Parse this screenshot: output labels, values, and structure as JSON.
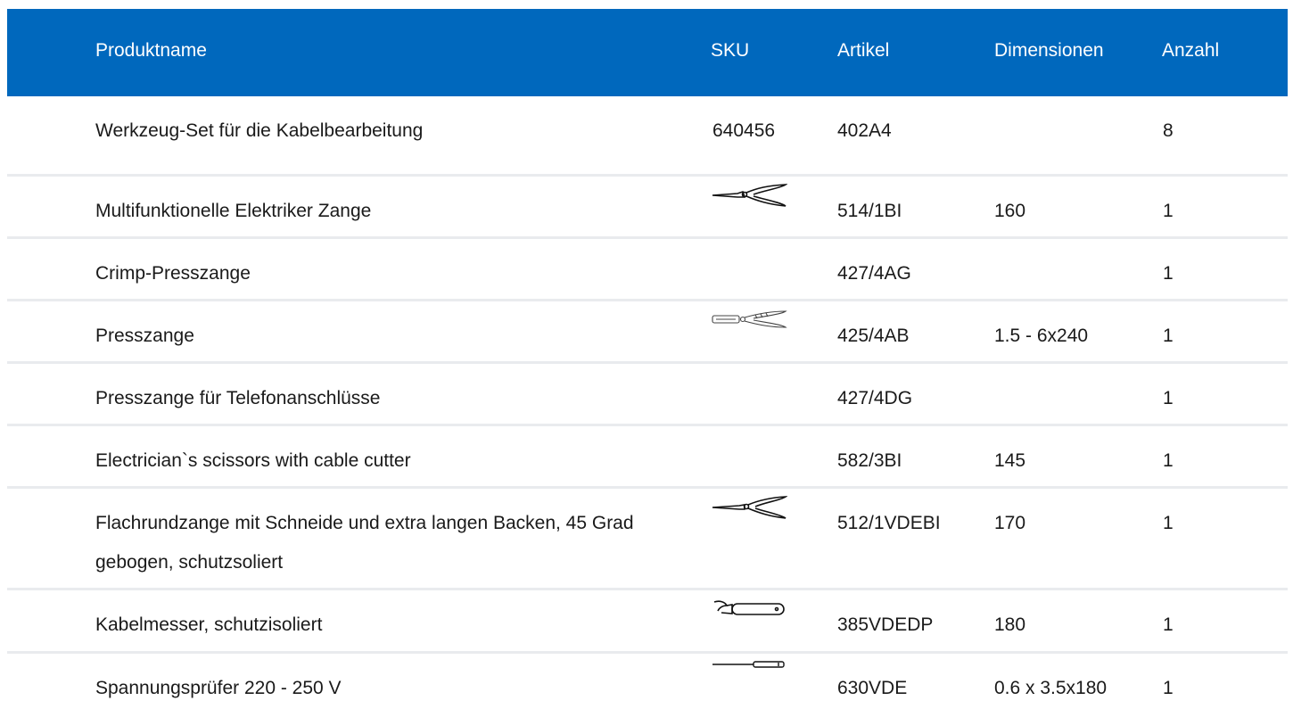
{
  "header": {
    "name": "Produktname",
    "sku": "SKU",
    "article": "Artikel",
    "dimensions": "Dimensionen",
    "quantity": "Anzahl"
  },
  "rows": [
    {
      "name": "Werkzeug-Set für die Kabelbearbeitung",
      "sku": "640456",
      "article": "402A4",
      "dimensions": "",
      "quantity": "8",
      "icon": ""
    },
    {
      "name": "Multifunktionelle Elektriker Zange",
      "sku": "",
      "article": "514/1BI",
      "dimensions": "160",
      "quantity": "1",
      "icon": "pliers-icon"
    },
    {
      "name": "Crimp-Presszange",
      "sku": "",
      "article": "427/4AG",
      "dimensions": "",
      "quantity": "1",
      "icon": ""
    },
    {
      "name": "Presszange",
      "sku": "",
      "article": "425/4AB",
      "dimensions": "1.5 - 6x240",
      "quantity": "1",
      "icon": "crimping-pliers-icon"
    },
    {
      "name": "Presszange für Telefonanschlüsse",
      "sku": "",
      "article": "427/4DG",
      "dimensions": "",
      "quantity": "1",
      "icon": ""
    },
    {
      "name": "Electrician`s scissors with cable cutter",
      "sku": "",
      "article": "582/3BI",
      "dimensions": "145",
      "quantity": "1",
      "icon": ""
    },
    {
      "name": "Flachrundzange mit Schneide und extra langen Backen, 45 Grad gebogen, schutzsoliert",
      "sku": "",
      "article": "512/1VDEBI",
      "dimensions": "170",
      "quantity": "1",
      "icon": "long-nose-pliers-icon"
    },
    {
      "name": "Kabelmesser, schutzisoliert",
      "sku": "",
      "article": "385VDEDP",
      "dimensions": "180",
      "quantity": "1",
      "icon": "cable-knife-icon"
    },
    {
      "name": "Spannungsprüfer 220 - 250 V",
      "sku": "",
      "article": "630VDE",
      "dimensions": "0.6 x 3.5x180",
      "quantity": "1",
      "icon": "voltage-tester-icon"
    }
  ],
  "colors": {
    "header_bg": "#0068bd",
    "header_text": "#ffffff",
    "row_divider": "#e9ebee",
    "body_text": "#1a1a1a"
  }
}
